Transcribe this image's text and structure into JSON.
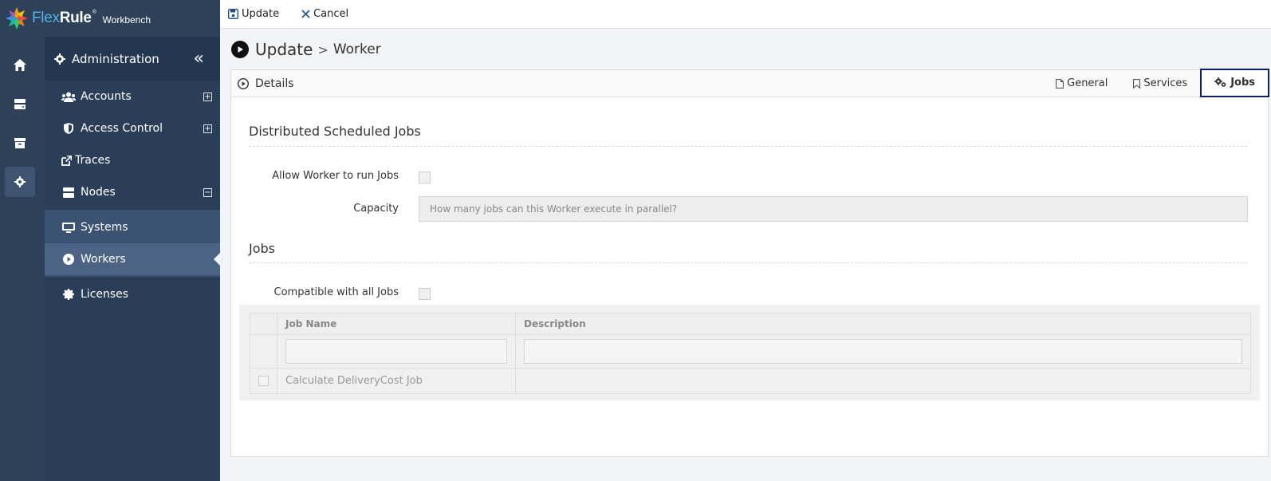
{
  "app": {
    "brand_part1": "Flex",
    "brand_part2": "Rule",
    "brand_reg": "®",
    "subtitle": "Workbench"
  },
  "rail": {
    "items": [
      "home-icon",
      "server-icon",
      "archive-icon",
      "gear-icon"
    ],
    "active": "gear-icon"
  },
  "sidebar": {
    "header": "Administration",
    "items": [
      {
        "label": "Accounts",
        "icon": "users-icon",
        "expander": "+"
      },
      {
        "label": "Access Control",
        "icon": "shield-icon",
        "expander": "+"
      },
      {
        "label": "Traces",
        "icon": "external-link-icon"
      },
      {
        "label": "Nodes",
        "icon": "server-icon",
        "expander": "−"
      },
      {
        "label": "Systems",
        "icon": "desktop-icon"
      },
      {
        "label": "Workers",
        "icon": "play-circle-icon",
        "selected": true
      },
      {
        "label": "Licenses",
        "icon": "certificate-icon"
      }
    ]
  },
  "toolbar": {
    "update_label": "Update",
    "cancel_label": "Cancel"
  },
  "page": {
    "title": "Update",
    "separator": ">",
    "subtitle": "Worker"
  },
  "panel": {
    "details_label": "Details",
    "tabs": [
      {
        "label": "General",
        "icon": "file-icon"
      },
      {
        "label": "Services",
        "icon": "bookmark-icon"
      },
      {
        "label": "Jobs",
        "icon": "gears-icon",
        "active": true
      }
    ]
  },
  "form": {
    "section1_title": "Distributed Scheduled Jobs",
    "allow_label": "Allow Worker to run Jobs",
    "allow_checked": false,
    "capacity_label": "Capacity",
    "capacity_placeholder": "How many jobs can this Worker execute in parallel?",
    "section2_title": "Jobs",
    "compatible_label": "Compatible with all Jobs",
    "compatible_checked": false
  },
  "jobs_table": {
    "columns": [
      "Job Name",
      "Description"
    ],
    "rows": [
      {
        "job_name": "Calculate DeliveryCost Job",
        "description": "",
        "checked": false
      }
    ]
  },
  "colors": {
    "sidebar_bg": "#2a3e57",
    "selected_item": "#4d6385",
    "active_tab_border": "#0b1f6b",
    "brand_blue": "#4fb3e8"
  }
}
